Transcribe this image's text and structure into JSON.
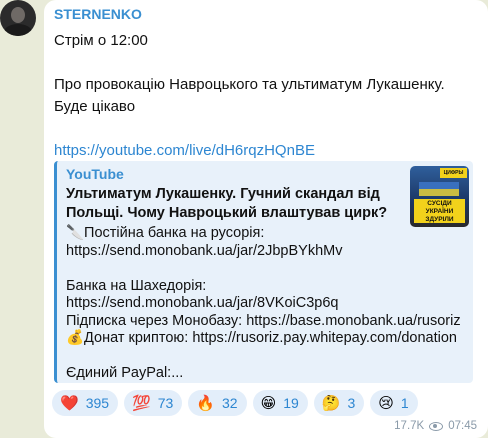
{
  "post": {
    "sender": "STERNENKO",
    "lines": {
      "l1": "Стрім о 12:00",
      "l2": "Про провокацію Навроцького та ультиматум Лукашенку. Буде цікаво",
      "link": "https://youtube.com/live/dH6rqzHQnBE"
    }
  },
  "preview": {
    "site": "YouTube",
    "title": "Ультиматум Лукашенку. Гучний скандал від Польщі. Чому Навроцький влаштував цирк?",
    "description": "🔪Постійна банка на русорія:\nhttps://send.monobank.ua/jar/2JbpBYkhMv\n\nБанка на Шахедорія:\nhttps://send.monobank.ua/jar/8VKoiC3p6q\nПідписка через Монобазу: https://base.monobank.ua/rusoriz\n💰Донат криптою: https://rusoriz.pay.whitepay.com/donation\n\nЄдиний PayPal:...",
    "thumb_top": "ЦИФРЫ",
    "thumb_tag": "СУСІДИ УКРАЇНИ ЗДУРІЛИ"
  },
  "reactions": [
    {
      "emoji": "❤️",
      "count": "395",
      "icon": "heart-icon"
    },
    {
      "emoji": "💯",
      "count": "73",
      "icon": "hundred-icon"
    },
    {
      "emoji": "🔥",
      "count": "32",
      "icon": "fire-icon"
    },
    {
      "emoji": "😁",
      "count": "19",
      "icon": "grin-icon"
    },
    {
      "emoji": "🤔",
      "count": "3",
      "icon": "thinking-icon"
    },
    {
      "emoji": "😢",
      "count": "1",
      "icon": "cry-icon"
    }
  ],
  "meta": {
    "views": "17.7K",
    "time": "07:45"
  },
  "colors": {
    "accent": "#3a8fd1",
    "link": "#2d86d1",
    "background": "#e9ebd9"
  }
}
